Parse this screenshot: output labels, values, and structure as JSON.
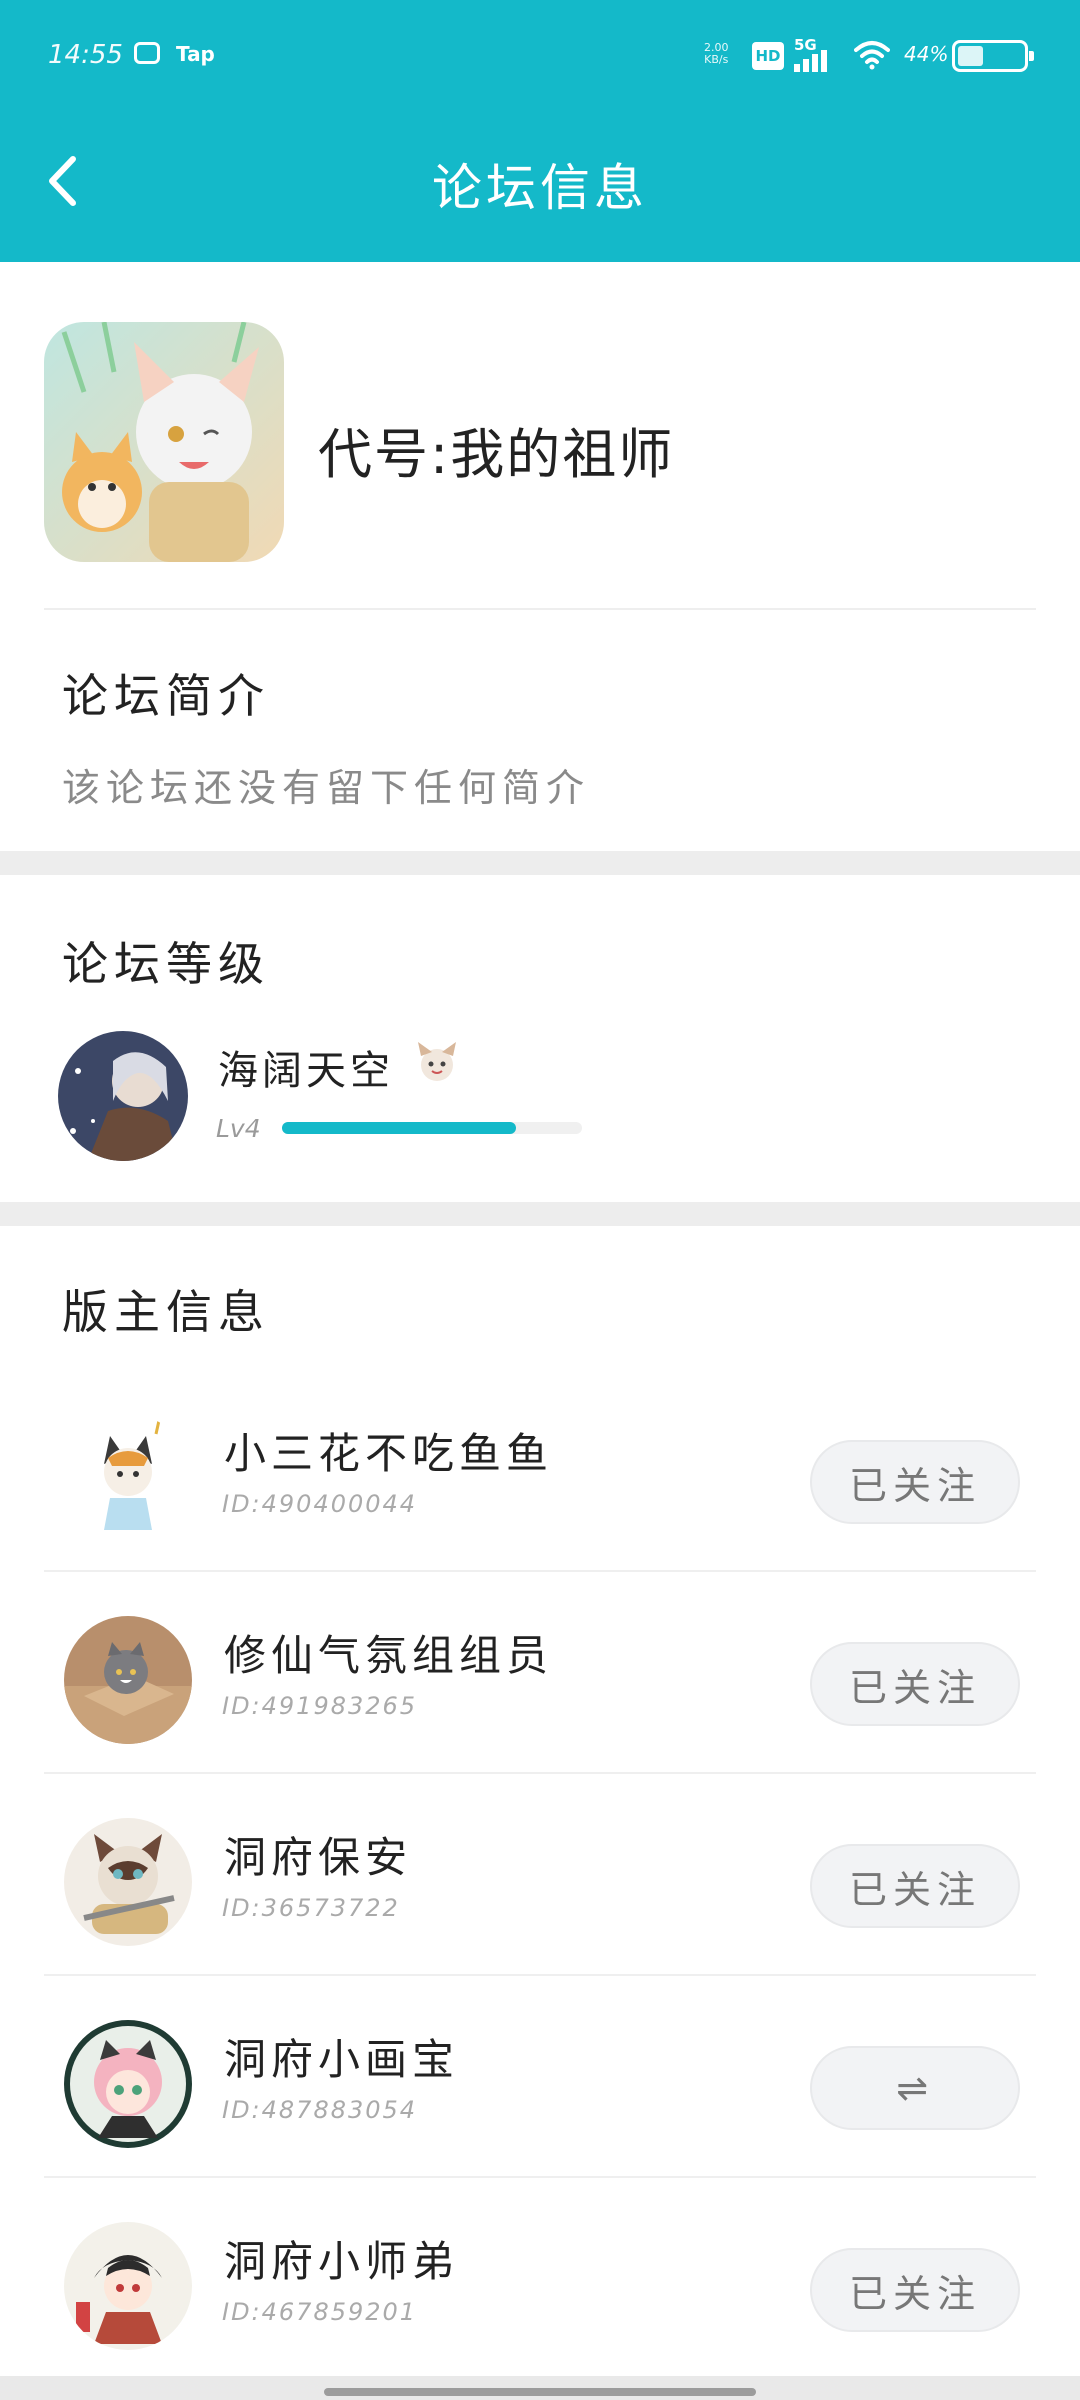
{
  "status_bar": {
    "time": "14:55",
    "app_label": "Tap",
    "net_speed_value": "2.00",
    "net_speed_unit": "KB/s",
    "hd": "HD",
    "network": "5G",
    "battery": "44%",
    "battery_level": 0.44
  },
  "header": {
    "title": "论坛信息"
  },
  "forum": {
    "name": "代号:我的祖师",
    "intro_heading": "论坛简介",
    "intro_text": "该论坛还没有留下任何简介"
  },
  "level": {
    "heading": "论坛等级",
    "user_name": "海阔天空",
    "level_label": "Lv4",
    "progress": 0.78
  },
  "moderators": {
    "heading": "版主信息",
    "items": [
      {
        "name": "小三花不吃鱼鱼",
        "id": "ID:490400044",
        "button": "已关注"
      },
      {
        "name": "修仙气氛组组员",
        "id": "ID:491983265",
        "button": "已关注"
      },
      {
        "name": "洞府保安",
        "id": "ID:36573722",
        "button": "已关注"
      },
      {
        "name": "洞府小画宝",
        "id": "ID:487883054",
        "button": "⇌"
      },
      {
        "name": "洞府小师弟",
        "id": "ID:467859201",
        "button": "已关注"
      }
    ]
  },
  "colors": {
    "accent": "#14b9c9",
    "separator": "#ededed"
  }
}
